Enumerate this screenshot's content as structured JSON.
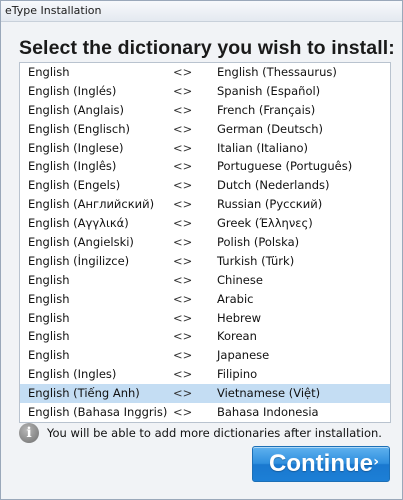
{
  "window": {
    "title": "eType Installation"
  },
  "heading": "Select the dictionary you wish to install:",
  "dictionaries": [
    {
      "source": "English",
      "arrow": "<>",
      "target": "English (Thessaurus)"
    },
    {
      "source": "English (Inglés)",
      "arrow": "<>",
      "target": "Spanish (Español)"
    },
    {
      "source": "English (Anglais)",
      "arrow": "<>",
      "target": "French (Français)"
    },
    {
      "source": "English (Englisch)",
      "arrow": "<>",
      "target": "German (Deutsch)"
    },
    {
      "source": "English (Inglese)",
      "arrow": "<>",
      "target": "Italian (Italiano)"
    },
    {
      "source": "English (Inglês)",
      "arrow": "<>",
      "target": "Portuguese (Português)"
    },
    {
      "source": "English (Engels)",
      "arrow": "<>",
      "target": "Dutch (Nederlands)"
    },
    {
      "source": "English (Английский)",
      "arrow": "<>",
      "target": "Russian (Русский)"
    },
    {
      "source": "English (Αγγλικά)",
      "arrow": "<>",
      "target": "Greek (Έλληνες)"
    },
    {
      "source": "English (Angielski)",
      "arrow": "<>",
      "target": "Polish (Polska)"
    },
    {
      "source": "English (İngilizce)",
      "arrow": "<>",
      "target": "Turkish (Türk)"
    },
    {
      "source": "English",
      "arrow": "<>",
      "target": "Chinese"
    },
    {
      "source": "English",
      "arrow": "<>",
      "target": "Arabic"
    },
    {
      "source": "English",
      "arrow": "<>",
      "target": "Hebrew"
    },
    {
      "source": "English",
      "arrow": "<>",
      "target": "Korean"
    },
    {
      "source": "English",
      "arrow": "<>",
      "target": "Japanese"
    },
    {
      "source": "English (Ingles)",
      "arrow": "<>",
      "target": "Filipino"
    },
    {
      "source": "English (Tiếng Anh)",
      "arrow": "<>",
      "target": "Vietnamese (Việt)",
      "selected": true
    },
    {
      "source": "English (Bahasa Inggris)",
      "arrow": "<>",
      "target": "Bahasa Indonesia"
    }
  ],
  "info": {
    "icon": "info-icon",
    "text": "You will be able to add more dictionaries after installation."
  },
  "continue_button": {
    "label": "Continue",
    "chevron": "›"
  },
  "colors": {
    "selected_row": "#c4ddf3",
    "button_blue": "#2f8fde"
  }
}
